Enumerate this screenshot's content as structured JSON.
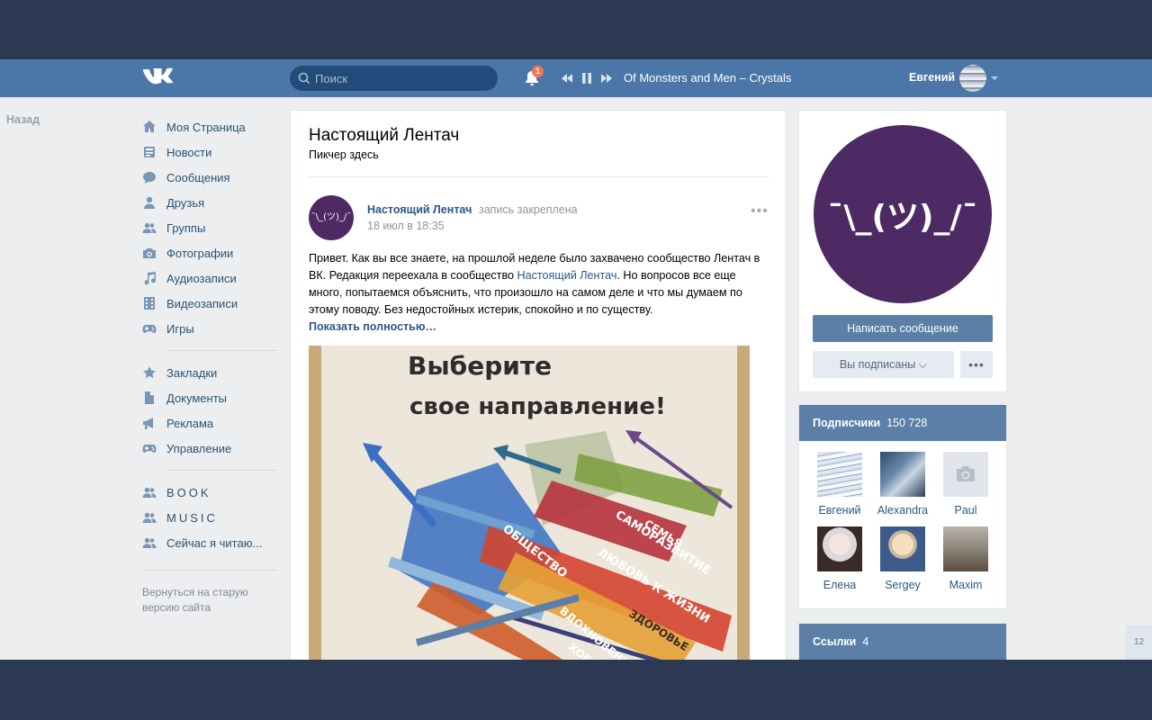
{
  "header": {
    "logo": "vk-logo",
    "search_placeholder": "Поиск",
    "notifications_count": "1",
    "track": "Of Monsters and Men – Crystals",
    "user_name": "Евгений"
  },
  "back_label": "Назад",
  "sidebar": {
    "items": [
      {
        "label": "Моя Страница",
        "icon": "home-icon"
      },
      {
        "label": "Новости",
        "icon": "news-icon"
      },
      {
        "label": "Сообщения",
        "icon": "messages-icon"
      },
      {
        "label": "Друзья",
        "icon": "friends-icon"
      },
      {
        "label": "Группы",
        "icon": "groups-icon"
      },
      {
        "label": "Фотографии",
        "icon": "camera-icon"
      },
      {
        "label": "Аудиозаписи",
        "icon": "music-icon"
      },
      {
        "label": "Видеозаписи",
        "icon": "video-icon"
      },
      {
        "label": "Игры",
        "icon": "gamepad-icon"
      }
    ],
    "items2": [
      {
        "label": "Закладки",
        "icon": "star-icon"
      },
      {
        "label": "Документы",
        "icon": "document-icon"
      },
      {
        "label": "Реклама",
        "icon": "megaphone-icon"
      },
      {
        "label": "Управление",
        "icon": "gamepad-icon"
      }
    ],
    "groups": [
      {
        "label": "BOOK"
      },
      {
        "label": "MUSIC"
      },
      {
        "label": "Сейчас я читаю..."
      }
    ],
    "old_version": "Вернуться на старую версию сайта"
  },
  "page": {
    "title": "Настоящий Лентач",
    "subtitle": "Пикчер здесь"
  },
  "post": {
    "avatar_text": "¯\\_(ツ)_/¯",
    "author": "Настоящий Лентач",
    "pinned": "запись закреплена",
    "date": "18 июл в 18:35",
    "more": "•••",
    "text_part1": "Привет. Как вы все знаете, на прошлой неделе было захвачено сообщество Лентач в ВК. Редакция переехала в сообщество ",
    "text_link": "Настоящий Лентач",
    "text_part2": ". Но вопросов все еще много, попытаемся объяснить, что произошло на самом деле и что мы думаем по этому поводу. Без недостойных истерик, спокойно и по существу.",
    "show_more": "Показать полностью…",
    "image": {
      "title_line1": "Выберите",
      "title_line2": "свое направление!",
      "labels": [
        "СЕМЬЯ",
        "САМОРАЗВИТИЕ",
        "ОБЩЕСТВО",
        "ЛЮБОВЬ К ЖИЗНИ",
        "ЗДОРОВЬЕ",
        "ВДОХНОВЕНИЕ",
        "ХОББИ"
      ]
    }
  },
  "profile": {
    "avatar_text": "¯\\_(ツ)_/¯",
    "write_message": "Написать сообщение",
    "subscribed": "Вы подписаны ⌵",
    "dots": "•••"
  },
  "subscribers": {
    "title": "Подписчики",
    "count": "150 728",
    "people": [
      {
        "name": "Евгений"
      },
      {
        "name": "Alexandra"
      },
      {
        "name": "Paul"
      },
      {
        "name": "Елена"
      },
      {
        "name": "Sergey"
      },
      {
        "name": "Maxim"
      }
    ]
  },
  "links": {
    "title": "Ссылки",
    "count": "4"
  },
  "scroll_page_number": "12",
  "colors": {
    "topbar": "#4a76a8",
    "accent": "#5b7fa6",
    "link": "#2a5885",
    "group_avatar": "#4d2a63",
    "badge": "#ff734c"
  }
}
